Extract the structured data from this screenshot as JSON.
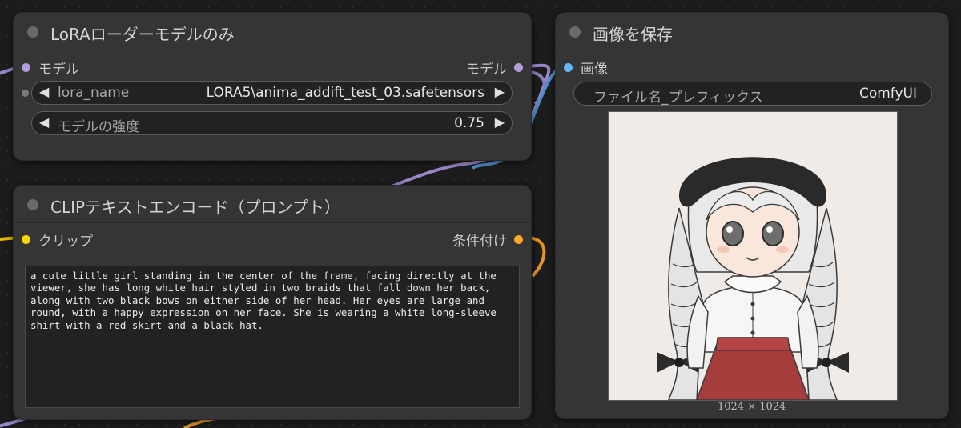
{
  "lora_node": {
    "title": "LoRAローダーモデルのみ",
    "input_label": "モデル",
    "output_label": "モデル",
    "lora_name_label": "lora_name",
    "lora_name_value": "LORA5\\anima_addift_test_03.safetensors",
    "strength_label": "モデルの強度",
    "strength_value": "0.75"
  },
  "clip_node": {
    "title": "CLIPテキストエンコード（プロンプト）",
    "input_label": "クリップ",
    "output_label": "条件付け",
    "prompt_text": "a cute little girl standing in the center of the frame, facing directly at the viewer, she has long white hair styled in two braids that fall down her back, along with two black bows on either side of her head. Her eyes are large and round, with a happy expression on her face. She is wearing a white long-sleeve shirt with a red skirt and a black hat."
  },
  "save_node": {
    "title": "画像を保存",
    "input_label": "画像",
    "prefix_label": "ファイル名_プレフィックス",
    "prefix_value": "ComfyUI",
    "image_size": "1024 × 1024"
  },
  "colors": {
    "model_slot": "#b39ddb",
    "clip_slot": "#ffd500",
    "conditioning_slot": "#ffa931",
    "image_slot": "#64b5f6",
    "node_bg": "#353535",
    "canvas_bg": "#1c1c1c"
  },
  "icons": {
    "decrement": "left-arrow-icon",
    "increment": "right-arrow-icon"
  }
}
